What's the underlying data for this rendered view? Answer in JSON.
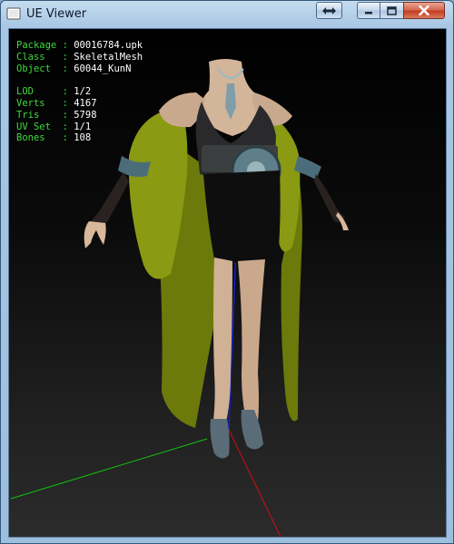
{
  "window": {
    "title": "UE Viewer",
    "icon": "app-icon",
    "controls": [
      "swap-icon",
      "minimize-icon",
      "maximize-icon",
      "close-icon"
    ]
  },
  "info": {
    "package": {
      "key": "Package",
      "sep": " : ",
      "value": "00016784.upk"
    },
    "class": {
      "key": "Class  ",
      "sep": " : ",
      "value": "SkeletalMesh"
    },
    "object": {
      "key": "Object ",
      "sep": " : ",
      "value": "60044_KunN"
    },
    "lod": {
      "key": "LOD    ",
      "sep": " : ",
      "value": "1/2"
    },
    "verts": {
      "key": "Verts  ",
      "sep": " : ",
      "value": "4167"
    },
    "tris": {
      "key": "Tris   ",
      "sep": " : ",
      "value": "5798"
    },
    "uvset": {
      "key": "UV Set ",
      "sep": " : ",
      "value": "1/1"
    },
    "bones": {
      "key": "Bones  ",
      "sep": " : ",
      "value": "108"
    }
  },
  "colors": {
    "label_green": "#3ddc3d",
    "value_white": "#ffffff",
    "robe": "#7a8a0c",
    "axis_x": "#d01010",
    "axis_y": "#10c010",
    "axis_z": "#1020d0"
  }
}
